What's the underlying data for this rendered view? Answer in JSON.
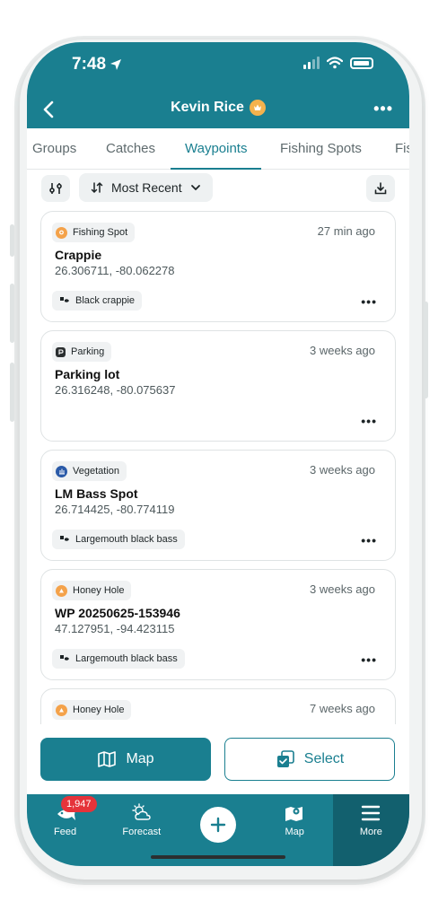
{
  "status_bar": {
    "time": "7:48"
  },
  "header": {
    "title": "Kevin Rice"
  },
  "tabs": [
    {
      "label": "Groups",
      "active": false
    },
    {
      "label": "Catches",
      "active": false
    },
    {
      "label": "Waypoints",
      "active": true
    },
    {
      "label": "Fishing Spots",
      "active": false
    },
    {
      "label": "Fis",
      "active": false
    }
  ],
  "toolbar": {
    "sort_label": "Most Recent"
  },
  "waypoints": [
    {
      "tag": "Fishing Spot",
      "tag_color": "#f4a24a",
      "time": "27 min ago",
      "name": "Crappie",
      "coords": "26.306711, -80.062278",
      "species": "Black crappie"
    },
    {
      "tag": "Parking",
      "tag_color": "#2b2f30",
      "time": "3 weeks ago",
      "name": "Parking lot",
      "coords": "26.316248, -80.075637",
      "species": ""
    },
    {
      "tag": "Vegetation",
      "tag_color": "#2a5aa8",
      "time": "3 weeks ago",
      "name": "LM Bass Spot",
      "coords": "26.714425, -80.774119",
      "species": "Largemouth black bass"
    },
    {
      "tag": "Honey Hole",
      "tag_color": "#f4a24a",
      "time": "3 weeks ago",
      "name": "WP 20250625-153946",
      "coords": "47.127951, -94.423115",
      "species": "Largemouth black bass"
    },
    {
      "tag": "Honey Hole",
      "tag_color": "#f4a24a",
      "time": "7 weeks ago",
      "name": "",
      "coords": "",
      "species": ""
    }
  ],
  "actions": {
    "map_label": "Map",
    "select_label": "Select"
  },
  "bottom_nav": {
    "feed": {
      "label": "Feed",
      "badge": "1,947"
    },
    "forecast": {
      "label": "Forecast"
    },
    "map": {
      "label": "Map"
    },
    "more": {
      "label": "More"
    }
  },
  "colors": {
    "brand": "#1a7f90",
    "brand_dark": "#12606e",
    "badge_red": "#e5333a",
    "gold": "#f4b24d"
  }
}
